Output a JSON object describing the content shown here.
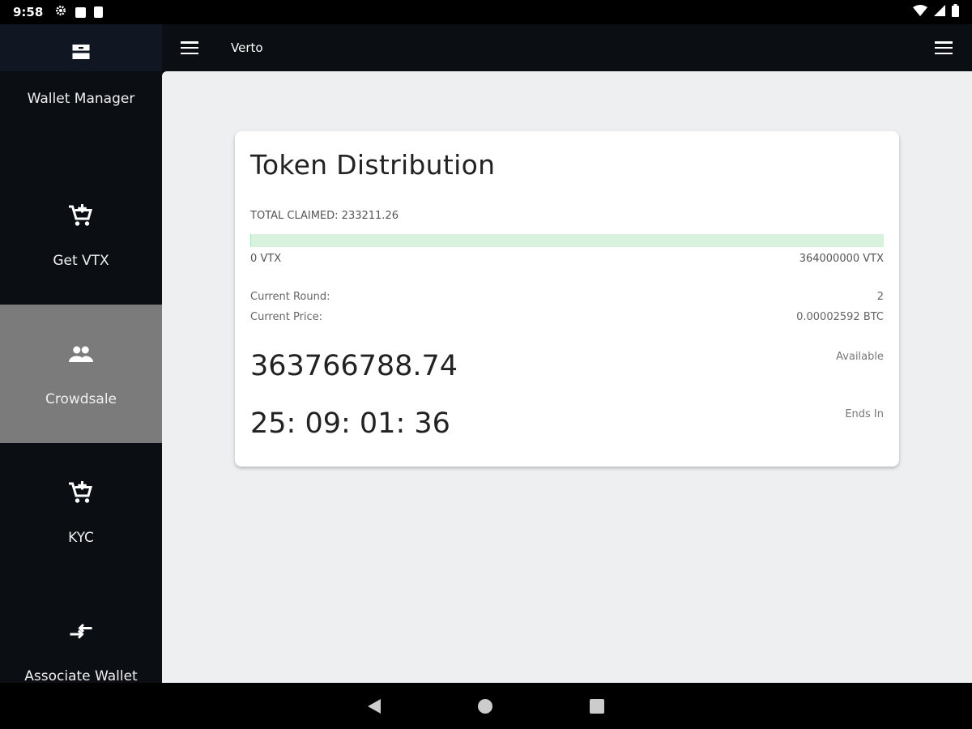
{
  "status": {
    "time": "9:58"
  },
  "app": {
    "title": "Verto"
  },
  "sidebar": {
    "items": [
      {
        "label": "Wallet Manager",
        "icon": "wallet-icon"
      },
      {
        "label": "Get VTX",
        "icon": "add-cart-icon"
      },
      {
        "label": "Crowdsale",
        "icon": "people-icon",
        "active": true
      },
      {
        "label": "KYC",
        "icon": "add-cart-icon"
      },
      {
        "label": "Associate Wallet",
        "icon": "swap-arrows-icon"
      }
    ]
  },
  "card": {
    "title": "Token Distribution",
    "total_claimed": "TOTAL CLAIMED: 233211.26",
    "progress_fraction": 0.00064,
    "range_min": "0 VTX",
    "range_max": "364000000 VTX",
    "current_round_label": "Current Round:",
    "current_round_value": "2",
    "current_price_label": "Current Price:",
    "current_price_value": "0.00002592 BTC",
    "available_value": "363766788.74",
    "available_label": "Available",
    "ends_value": "25: 09: 01: 36",
    "ends_label": "Ends In"
  },
  "colors": {
    "sidebar_bg": "#0b0e13",
    "active_item": "#7b7b7b",
    "progress": "#d8f2dd"
  }
}
